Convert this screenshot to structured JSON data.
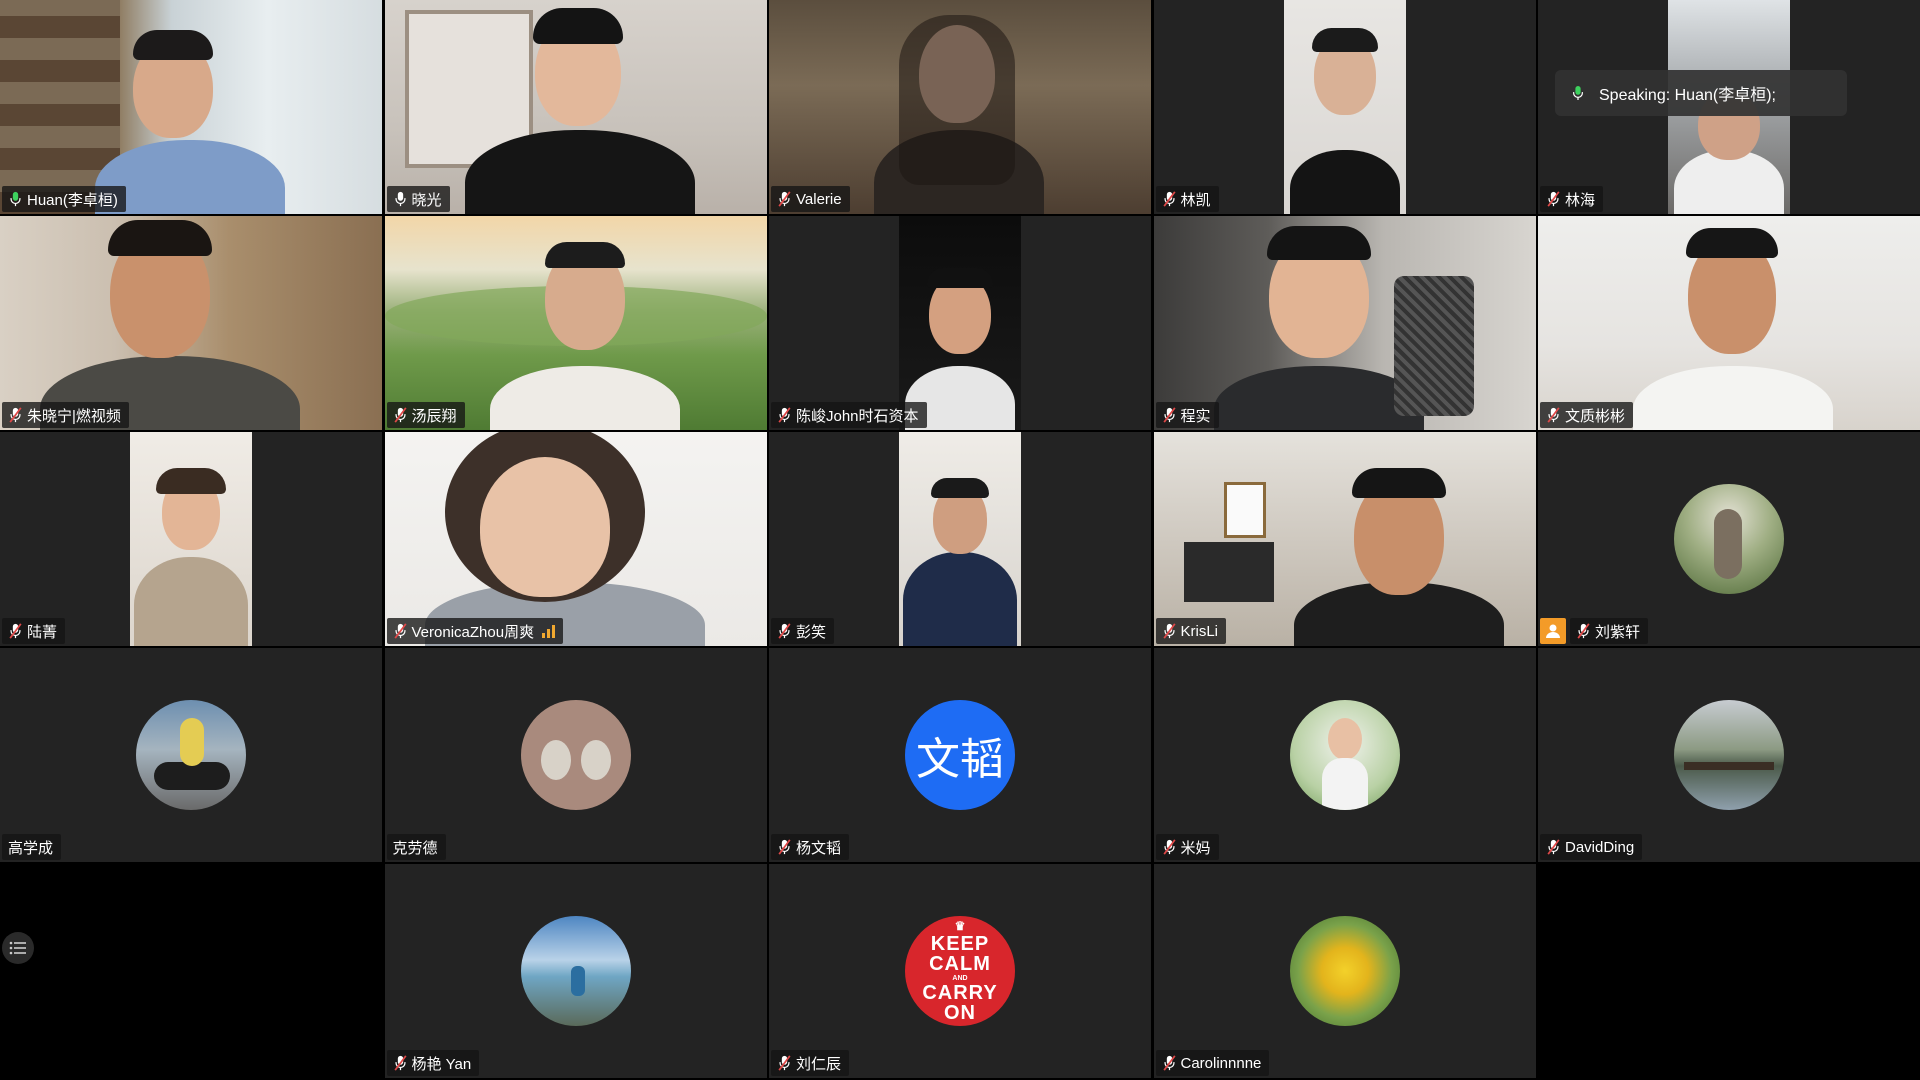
{
  "speaking_indicator": {
    "label": "Speaking: Huan(李卓桓);"
  },
  "participants": [
    {
      "name": "Huan(李卓桓)"
    },
    {
      "name": "晓光"
    },
    {
      "name": "Valerie"
    },
    {
      "name": "林凯"
    },
    {
      "name": "林海"
    },
    {
      "name": "朱晓宁|燃视频"
    },
    {
      "name": "汤辰翔"
    },
    {
      "name": "陈峻John时石资本"
    },
    {
      "name": "程实"
    },
    {
      "name": "文质彬彬"
    },
    {
      "name": "陆菁"
    },
    {
      "name": "VeronicaZhou周爽"
    },
    {
      "name": "彭笑"
    },
    {
      "name": "KrisLi"
    },
    {
      "name": "刘紫轩"
    },
    {
      "name": "高学成"
    },
    {
      "name": "克劳德"
    },
    {
      "name": "杨文韬",
      "avatar_text": "文韬"
    },
    {
      "name": "米妈"
    },
    {
      "name": "DavidDing"
    },
    {
      "name": "杨艳 Yan"
    },
    {
      "name": "刘仁辰",
      "avatar_poster": {
        "line1": "KEEP",
        "line2": "CALM",
        "line3": "AND",
        "line4": "CARRY",
        "line5": "ON"
      }
    },
    {
      "name": "Carolinnnne"
    }
  ],
  "colors": {
    "active_speaker_border": "#2fd05a",
    "tile_bg": "#232323",
    "muted_icon": "#e04848",
    "mic_on": "#3dd15e"
  },
  "icons": {
    "unmuted": "mic-icon",
    "muted": "mic-muted-icon",
    "audio_level": "audio-level-icon",
    "participant_list": "list-icon",
    "no_video": "person-icon"
  }
}
